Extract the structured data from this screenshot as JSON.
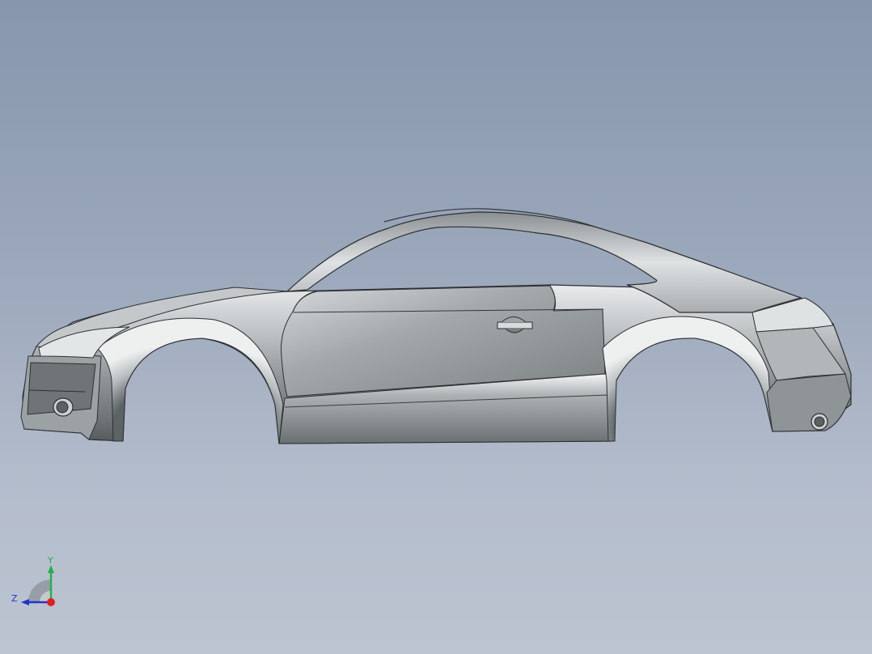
{
  "viewport": {
    "background_top": "#8796ad",
    "background_bottom": "#bcc4d1",
    "model": "car-body-shell",
    "view": "side"
  },
  "triad": {
    "y_label": "Y",
    "z_label": "Z",
    "colors": {
      "y_axis": "#22b14c",
      "z_axis": "#2233cc",
      "x_axis": "#e02020"
    }
  }
}
